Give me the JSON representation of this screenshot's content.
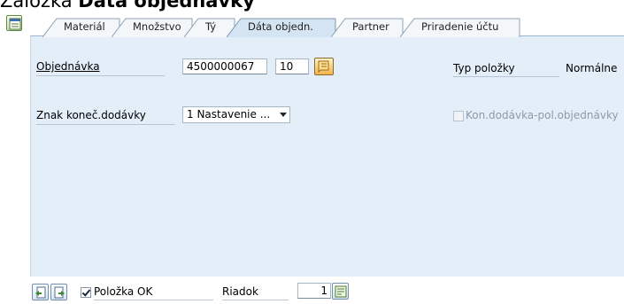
{
  "heading": {
    "prefix": "Záložka ",
    "bold": "Dáta objednávky"
  },
  "tabs": [
    {
      "label": "Materiál",
      "active": false
    },
    {
      "label": "Množstvo",
      "active": false
    },
    {
      "label": "Tý",
      "active": false
    },
    {
      "label": "Dáta objedn.",
      "active": true
    },
    {
      "label": "Partner",
      "active": false
    },
    {
      "label": "Priradenie účtu",
      "active": false
    }
  ],
  "form": {
    "order_label": "Objednávka",
    "order_number": "4500000067",
    "order_item": "10",
    "item_type_label": "Typ položky",
    "item_type_value": "Normálne",
    "final_delivery_label": "Znak koneč.dodávky",
    "final_delivery_value": "1 Nastavenie ...",
    "final_delivery_item_label": "Kon.dodávka-pol.objednávky",
    "final_delivery_item_checked": false
  },
  "footer": {
    "item_ok_label": "Položka OK",
    "item_ok_checked": true,
    "row_label": "Riadok",
    "row_value": "1"
  },
  "icons": {
    "expand": "expand-header-icon",
    "history": "history-icon",
    "prev": "previous-item-icon",
    "next": "next-item-icon",
    "row_search": "row-search-icon"
  }
}
